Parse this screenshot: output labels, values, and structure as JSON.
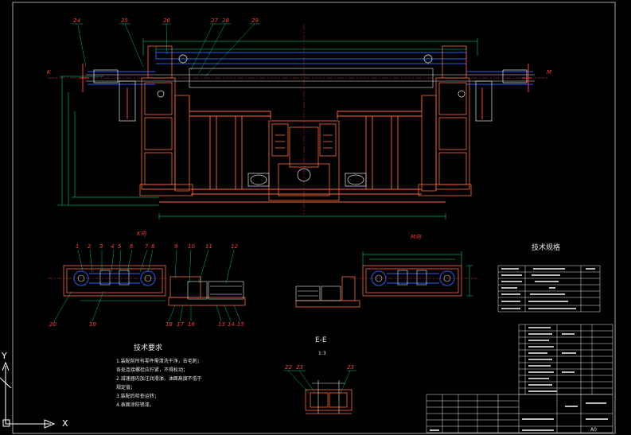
{
  "drawing": {
    "part_numbers_top": [
      "24",
      "25",
      "26",
      "27",
      "28",
      "29"
    ],
    "part_numbers_left": [
      "1",
      "2",
      "3",
      "4",
      "5",
      "6",
      "7",
      "8",
      "9",
      "10",
      "11",
      "12"
    ],
    "part_numbers_left_bottom": [
      "20",
      "19",
      "18",
      "17",
      "16",
      "13",
      "14",
      "15"
    ],
    "part_numbers_section": [
      "22",
      "23",
      "23"
    ],
    "marker_left": "K",
    "marker_right": "M",
    "view_k_label": "K向",
    "view_m_label": "M向",
    "section_label": "E-E",
    "section_scale": "1:3",
    "table_title": "技术规格",
    "notes_title": "技术要求",
    "notes": [
      "1.装配前所有零件需清洗干净，去毛刺；",
      "  各处连接螺栓应拧紧，不得松动；",
      "2.减速器内加注润滑油，油面高度不低于",
      "  规定值；",
      "3.装配后检查运转；",
      "4.表面涂防锈漆。"
    ],
    "title_block_sheet": "A0"
  },
  "ucs": {
    "y_label": "Y",
    "x_label": "X"
  }
}
